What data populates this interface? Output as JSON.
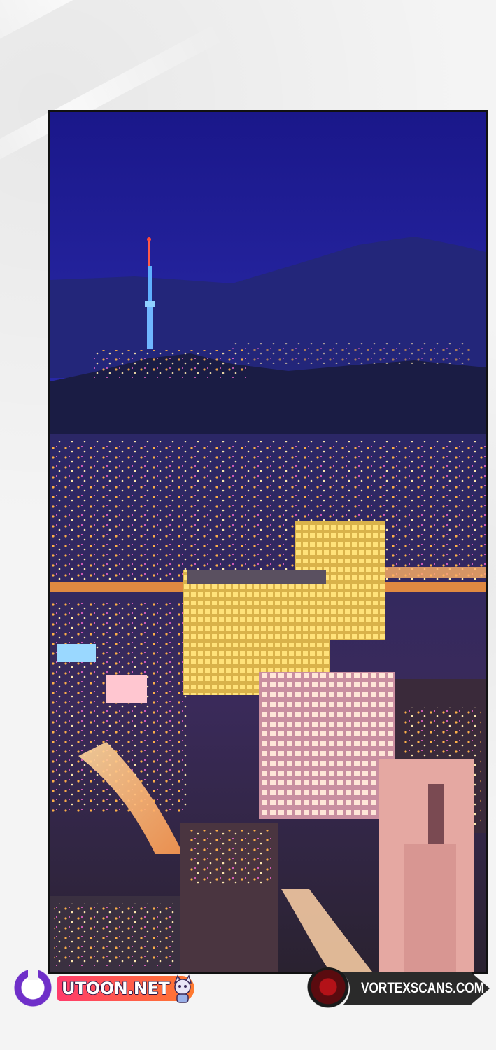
{
  "scene": {
    "description_icon": "night-city-skyline-icon",
    "colors": {
      "sky": "#1f1c8a",
      "mountain": "#1a1d4a",
      "city_lights": "#ff9a3c",
      "tower": "#6fb6ff"
    }
  },
  "watermarks": {
    "left": {
      "text": "UTOON.NET",
      "logo_icon": "u-ring-logo-icon",
      "mascot_icon": "cat-mascot-icon"
    },
    "right": {
      "text": "VORTEXSCANS.COM",
      "logo_icon": "vortex-flame-logo-icon"
    }
  }
}
